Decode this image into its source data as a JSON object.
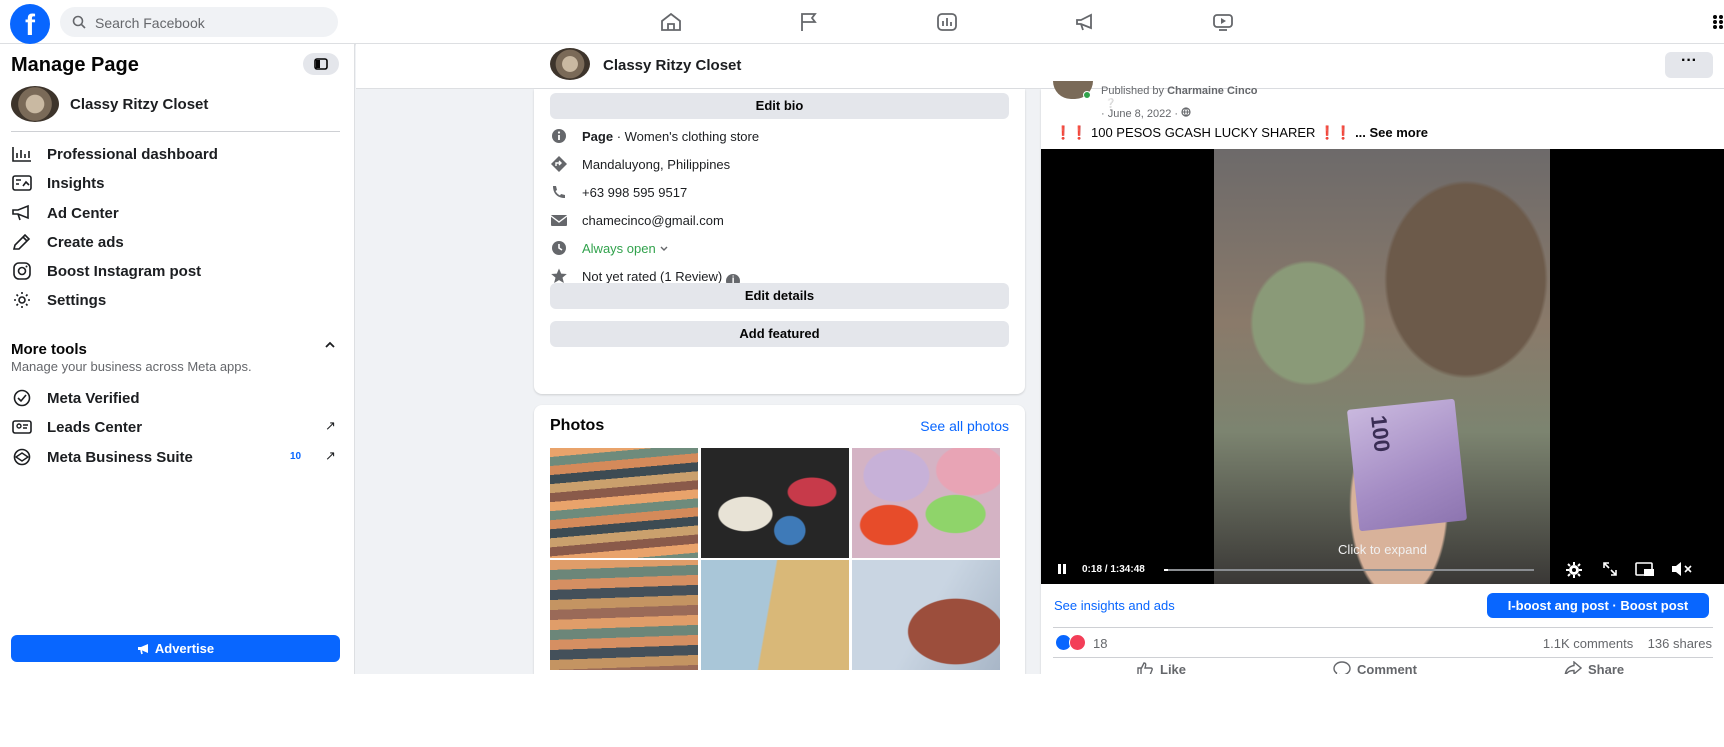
{
  "topbar": {
    "logo": "f",
    "search_placeholder": "Search Facebook"
  },
  "sidebar": {
    "title": "Manage Page",
    "page_name": "Classy Ritzy Closet",
    "items": [
      {
        "label": "Professional dashboard",
        "icon": "dashboard-icon"
      },
      {
        "label": "Insights",
        "icon": "insights-icon"
      },
      {
        "label": "Ad Center",
        "icon": "ad-center-icon"
      },
      {
        "label": "Create ads",
        "icon": "pencil-icon"
      },
      {
        "label": "Boost Instagram post",
        "icon": "instagram-icon"
      },
      {
        "label": "Settings",
        "icon": "gear-icon"
      }
    ],
    "more_tools": {
      "title": "More tools",
      "subtitle": "Manage your business across Meta apps.",
      "items": [
        {
          "label": "Meta Verified",
          "icon": "verified-icon"
        },
        {
          "label": "Leads Center",
          "icon": "leads-icon",
          "arrow": "↗"
        },
        {
          "label": "Meta Business Suite",
          "icon": "business-suite-icon",
          "badge": "10",
          "arrow": "↗"
        }
      ]
    },
    "advertise_label": "Advertise"
  },
  "page_header": {
    "name": "Classy Ritzy Closet",
    "more": "···"
  },
  "intro": {
    "edit_bio": "Edit bio",
    "category_prefix": "Page",
    "category": " · Women's clothing store",
    "location": "Mandaluyong, Philippines",
    "phone": "+63 998 595 9517",
    "email": "chamecinco@gmail.com",
    "hours": "Always open",
    "rating": "Not yet rated (1 Review)",
    "edit_details": "Edit details",
    "add_featured": "Add featured"
  },
  "photos": {
    "title": "Photos",
    "see_all": "See all photos"
  },
  "post": {
    "published_prefix": "Published by",
    "author": "Charmaine Cinco",
    "date": "· June 8, 2022 ·",
    "text": " 100 PESOS GCASH LUCKY SHARER ",
    "exclaim": "❗❗",
    "see_more": "... See more",
    "banknote": "100",
    "click_to_expand": "Click to expand",
    "time": "0:18 / 1:34:48",
    "progress": 0.01,
    "insights_link": "See insights and ads",
    "boost_label": "I-boost ang post · Boost post",
    "reaction_count": "18",
    "comments": "1.1K comments",
    "shares": "136 shares",
    "actions": {
      "like": "Like",
      "comment": "Comment",
      "share": "Share"
    }
  },
  "colors": {
    "brand": "#0866ff",
    "green": "#31a24c",
    "background": "#f0f2f5"
  }
}
